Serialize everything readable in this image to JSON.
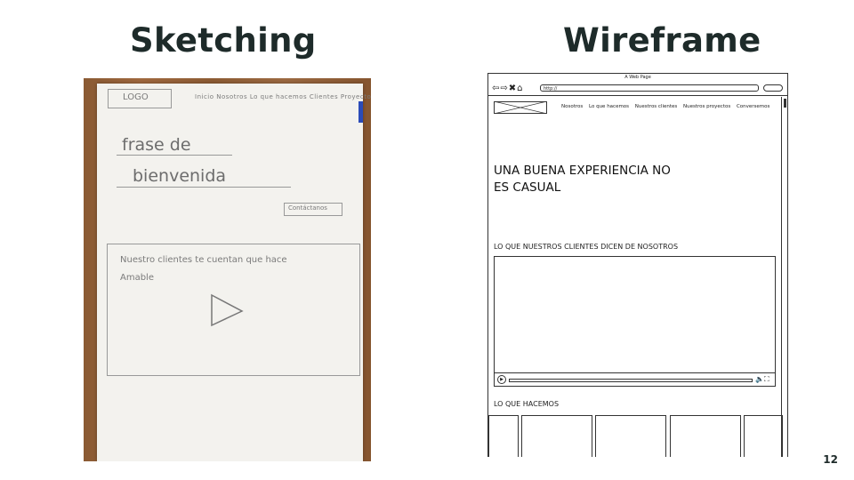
{
  "slide": {
    "left_title": "Sketching",
    "right_title": "Wireframe",
    "page_number": "12"
  },
  "sketch": {
    "logo": "LOGO",
    "nav": "Inicio  Nosotros  Lo que hacemos  Clientes  Proyectos  Contacto",
    "heading_line1": "frase de",
    "heading_line2": "bienvenida",
    "button": "Contáctanos",
    "video_text_line1": "Nuestro clientes te cuentan que hace",
    "video_text_line2": "Amable"
  },
  "wireframe": {
    "window_title": "A Web Page",
    "url": "http://",
    "nav_items": [
      "Nosotros",
      "Lo que hacemos",
      "Nuestros clientes",
      "Nuestros proyectos",
      "Conversemos"
    ],
    "hero_line1": "UNA BUENA EXPERIENCIA NO",
    "hero_line2": "ES CASUAL",
    "section_clients": "LO QUE NUESTROS CLIENTES DICEN DE NOSOTROS",
    "section_services": "LO QUE HACEMOS",
    "icons": [
      "back-arrow-icon",
      "forward-arrow-icon",
      "close-icon",
      "home-icon",
      "play-icon",
      "volume-icon",
      "fullscreen-icon"
    ]
  }
}
